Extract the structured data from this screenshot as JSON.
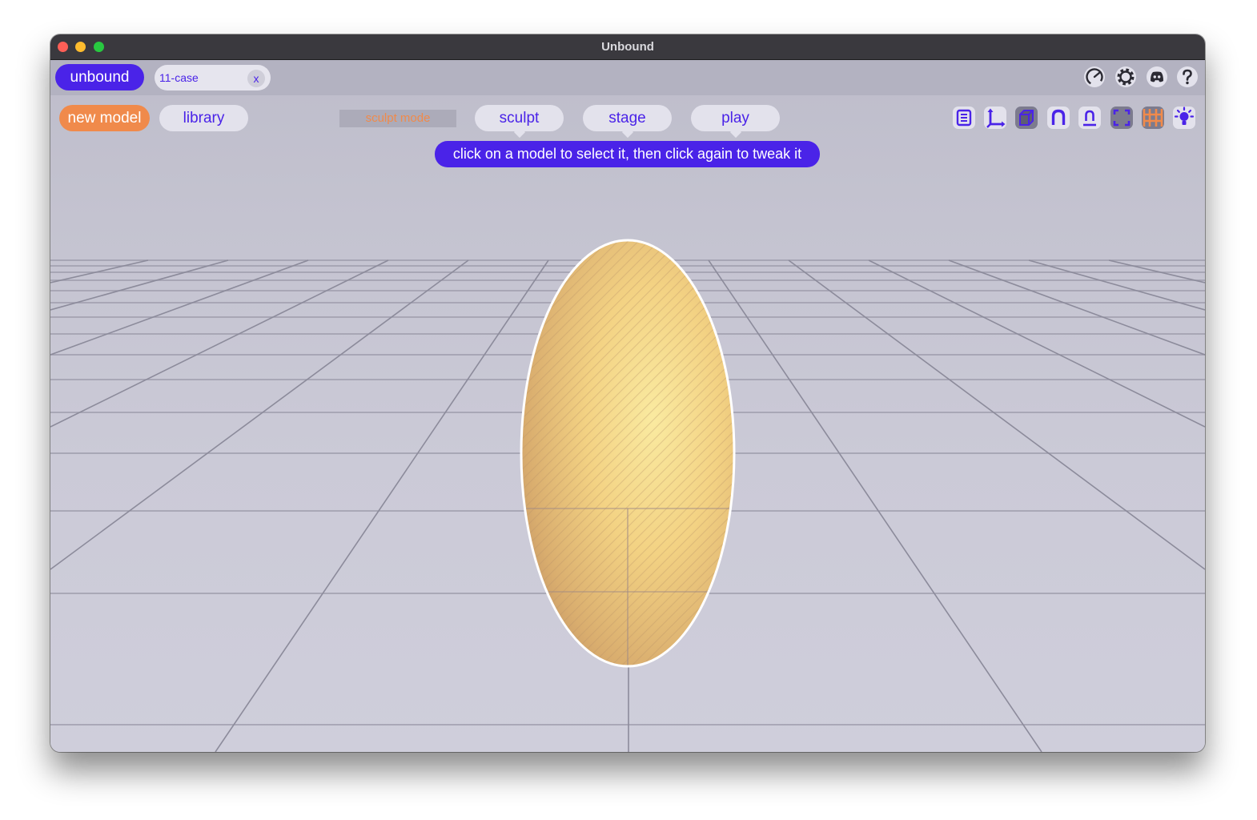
{
  "window": {
    "title": "Unbound"
  },
  "topbar": {
    "brand": "unbound",
    "tab": {
      "name": "11-case",
      "close": "x"
    },
    "icons": [
      "performance-gauge-icon",
      "settings-gear-icon",
      "discord-icon",
      "help-icon"
    ]
  },
  "toolbar": {
    "new_model": "new model",
    "library": "library",
    "mode_label": "sculpt mode",
    "modes": [
      "sculpt",
      "stage",
      "play"
    ],
    "tools": [
      "list-panel-icon",
      "axes-gizmo-icon",
      "solid-cube-icon",
      "magnet-snap-icon",
      "pin-snap-icon",
      "frame-focus-icon",
      "grid-toggle-icon",
      "light-bulb-icon"
    ]
  },
  "hint": "click on a model to select it, then click again to tweak it",
  "colors": {
    "accent": "#4a23e8",
    "orange": "#f08a4b",
    "egg": "#f3d283",
    "background": "#c9c8d6"
  }
}
